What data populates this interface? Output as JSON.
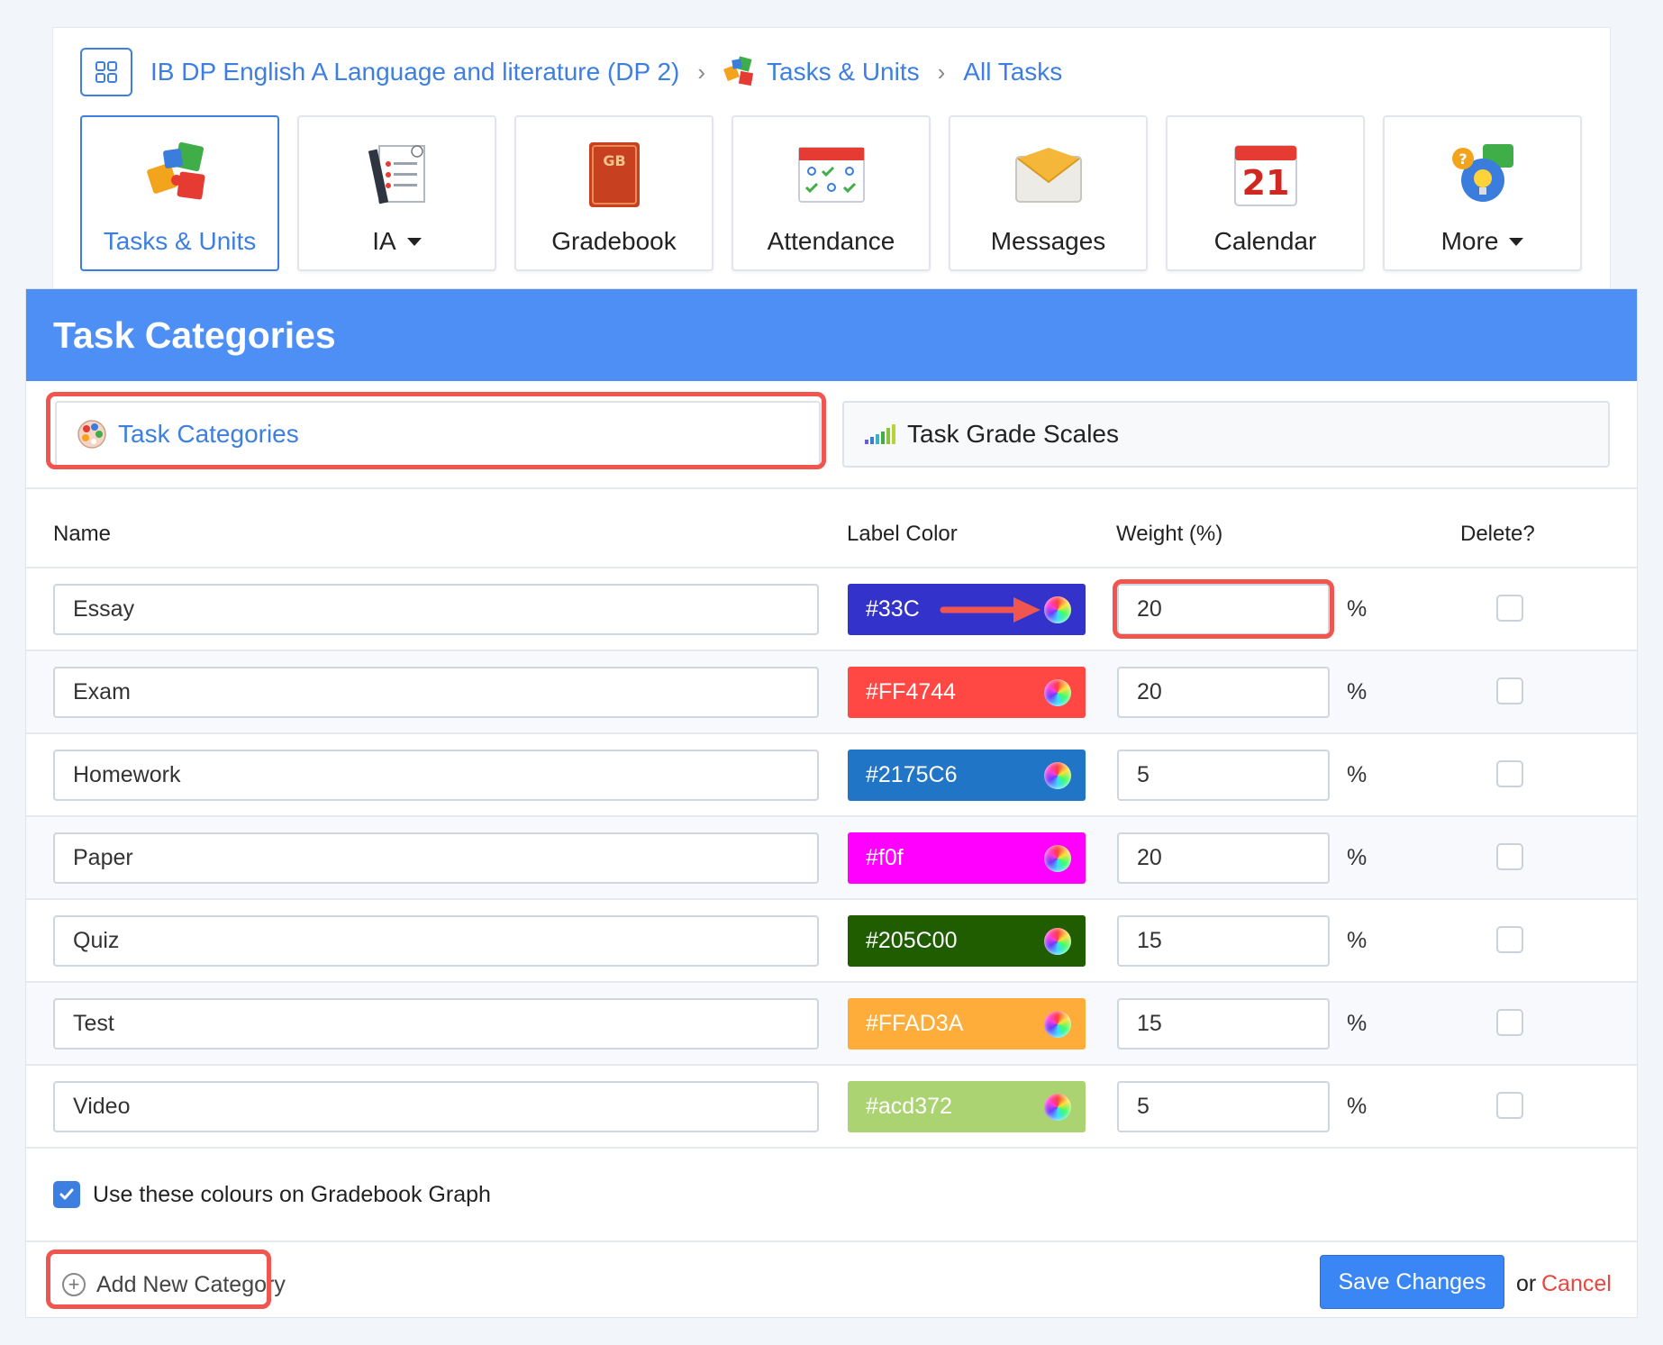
{
  "breadcrumb": {
    "course": "IB DP English A Language and literature (DP 2)",
    "section": "Tasks & Units",
    "page": "All Tasks"
  },
  "nav_tiles": [
    {
      "label": "Tasks & Units",
      "icon": "puzzle-icon",
      "active": true
    },
    {
      "label": "IA",
      "icon": "checklist-icon",
      "dropdown": true
    },
    {
      "label": "Gradebook",
      "icon": "gradebook-icon"
    },
    {
      "label": "Attendance",
      "icon": "attendance-icon"
    },
    {
      "label": "Messages",
      "icon": "envelope-icon"
    },
    {
      "label": "Calendar",
      "icon": "calendar-icon",
      "calendar_day": "21",
      "calendar_header": "Calendar"
    },
    {
      "label": "More",
      "icon": "help-bubble-icon",
      "dropdown": true
    }
  ],
  "panel": {
    "title": "Task Categories",
    "tabs": [
      {
        "label": "Task Categories",
        "icon": "palette-icon",
        "active": true
      },
      {
        "label": "Task Grade Scales",
        "icon": "bar-scale-icon"
      }
    ]
  },
  "table": {
    "headers": {
      "name": "Name",
      "color": "Label Color",
      "weight": "Weight (%)",
      "delete": "Delete?"
    },
    "rows": [
      {
        "name": "Essay",
        "color": "#33C",
        "weight": "20",
        "pct": "%"
      },
      {
        "name": "Exam",
        "color": "#FF4744",
        "weight": "20",
        "pct": "%"
      },
      {
        "name": "Homework",
        "color": "#2175C6",
        "weight": "5",
        "pct": "%"
      },
      {
        "name": "Paper",
        "color": "#f0f",
        "weight": "20",
        "pct": "%"
      },
      {
        "name": "Quiz",
        "color": "#205C00",
        "weight": "15",
        "pct": "%"
      },
      {
        "name": "Test",
        "color": "#FFAD3A",
        "weight": "15",
        "pct": "%"
      },
      {
        "name": "Video",
        "color": "#acd372",
        "weight": "5",
        "pct": "%"
      }
    ]
  },
  "options": {
    "gradebook_colours": "Use these colours on Gradebook Graph",
    "gradebook_colours_checked": true
  },
  "footer": {
    "add_label": "Add New Category",
    "save_label": "Save Changes",
    "or_text": "or",
    "cancel_label": "Cancel"
  },
  "colors": {
    "accent": "#3d7fe0",
    "header_bg": "#4d8ff5",
    "highlight": "#f0554f",
    "cancel": "#e8483f"
  }
}
